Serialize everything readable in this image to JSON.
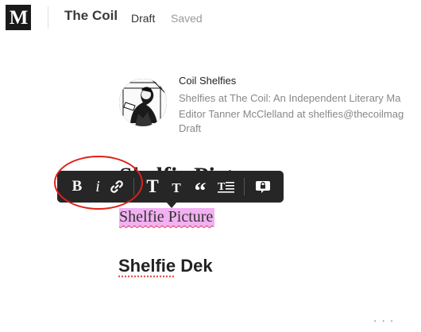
{
  "header": {
    "logo_letter": "M",
    "publication": "The Coil",
    "status": "Draft",
    "save_state": "Saved"
  },
  "author": {
    "name": "Coil Shelfies",
    "bio_line1": "Shelfies at The Coil: An Independent Literary Ma",
    "bio_line2": "Editor Tanner McClelland at shelfies@thecoilmag",
    "state": "Draft"
  },
  "editor": {
    "hidden_heading": "Shelfie Picture",
    "selected_text": "Shelfie Picture",
    "dek_word1": "Shelfie",
    "dek_word2": " Dek"
  },
  "toolbar": {
    "buttons": [
      {
        "name": "bold",
        "label": "B"
      },
      {
        "name": "italic",
        "label": "i"
      },
      {
        "name": "link",
        "icon": "link-icon"
      },
      {
        "name": "large-title",
        "label": "T"
      },
      {
        "name": "small-title",
        "label": "T"
      },
      {
        "name": "quote",
        "label": "“"
      },
      {
        "name": "drop-cap",
        "icon": "drop-cap-icon"
      },
      {
        "name": "private-note",
        "icon": "lock-speech-icon"
      }
    ]
  },
  "footer": {
    "more": "..."
  },
  "colors": {
    "highlight": "#f2b1f2",
    "toolbar": "#262626",
    "annotation_circle": "#e0201a"
  }
}
